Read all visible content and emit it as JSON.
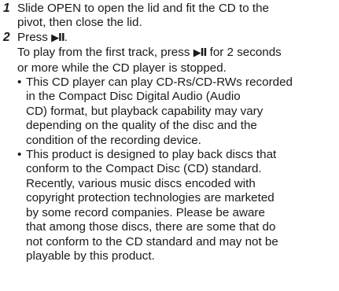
{
  "steps": [
    {
      "number": "1",
      "lines": [
        "Slide OPEN to open the lid and fit the CD to the",
        "pivot, then close the lid."
      ]
    },
    {
      "number": "2",
      "press_text": "Press",
      "press_symbol": "▶II",
      "press_end": ".",
      "para_before": "To play from the first track, press",
      "para_symbol": "▶II",
      "para_after": "for 2 seconds",
      "para_line2": "or more while the CD player is stopped.",
      "notes": [
        {
          "bullet": "•",
          "lines": [
            "This CD player can play CD-Rs/CD-RWs recorded",
            "in the Compact Disc Digital Audio (Audio",
            "CD) format, but playback capability may vary",
            "depending on the quality of the disc and the",
            "condition of the recording device."
          ]
        },
        {
          "bullet": "•",
          "lines": [
            "This product is designed to play back discs that",
            "conform to the Compact Disc (CD) standard.",
            "Recently, various music discs encoded with",
            "copyright protection technologies are marketed",
            "by some record companies. Please be aware",
            "that among those discs, there are some that do",
            "not conform to the CD standard and may not be",
            "playable by this product."
          ]
        }
      ]
    }
  ]
}
